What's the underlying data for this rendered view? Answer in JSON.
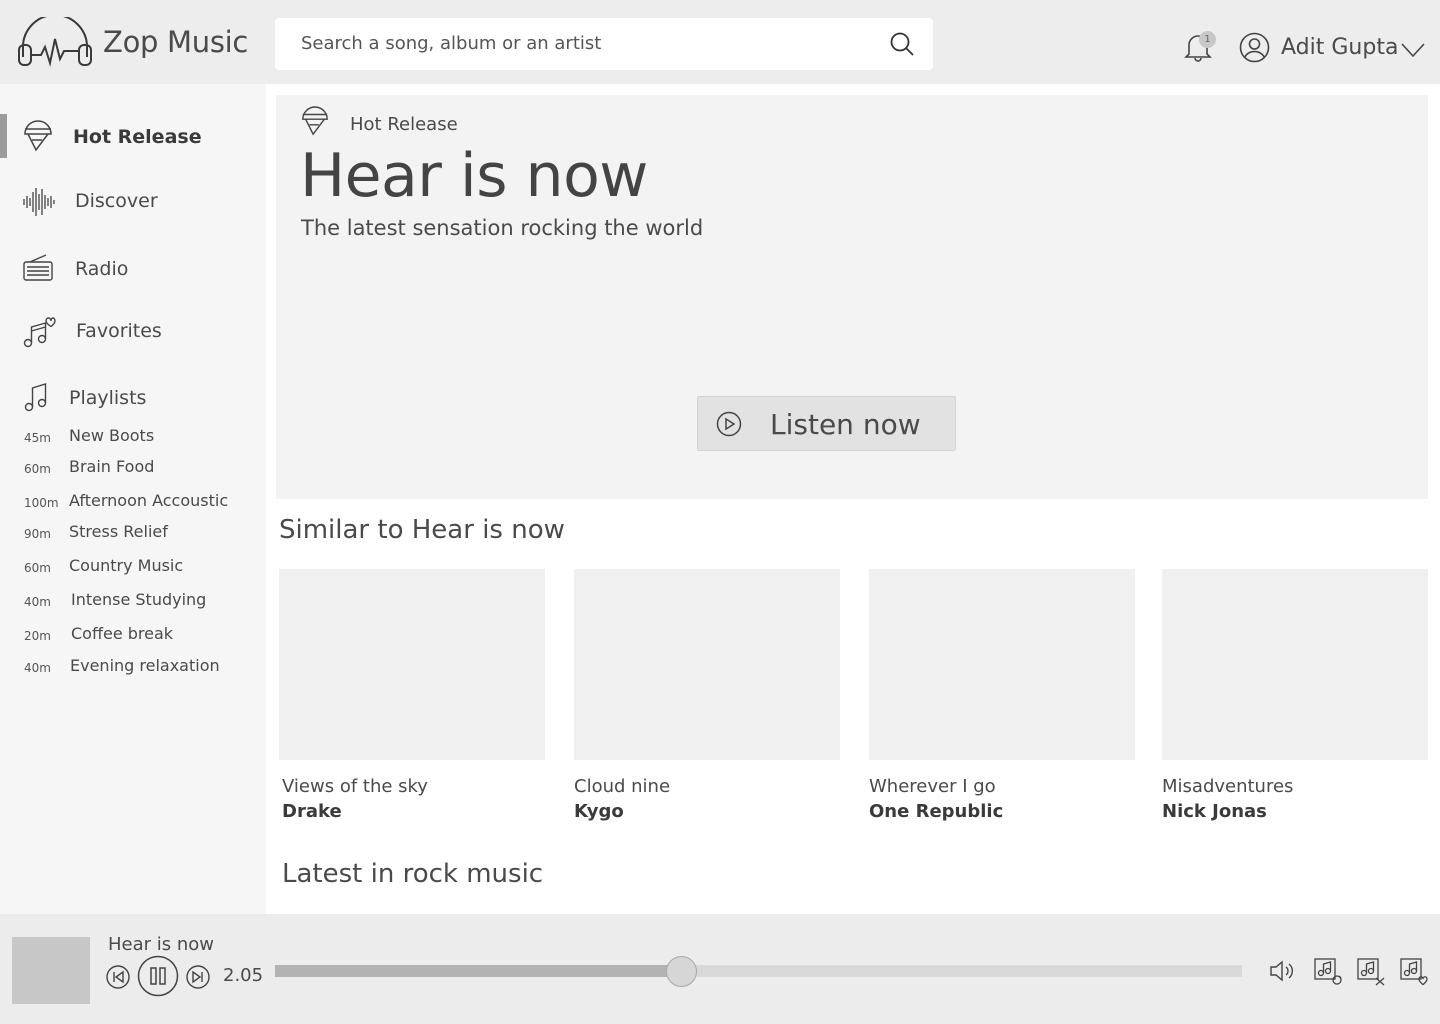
{
  "app": {
    "name": "Zop Music"
  },
  "search": {
    "placeholder": "Search a song, album or an artist"
  },
  "header": {
    "notification_count": "1",
    "user_name": "Adit Gupta"
  },
  "sidebar": {
    "nav": [
      {
        "label": "Hot Release",
        "icon": "hot-release-icon",
        "active": true
      },
      {
        "label": "Discover",
        "icon": "waveform-icon",
        "active": false
      },
      {
        "label": "Radio",
        "icon": "radio-icon",
        "active": false
      },
      {
        "label": "Favorites",
        "icon": "favorites-icon",
        "active": false
      }
    ],
    "playlists_label": "Playlists",
    "playlists": [
      {
        "duration": "45m",
        "name": "New Boots"
      },
      {
        "duration": "60m",
        "name": "Brain Food"
      },
      {
        "duration": "100m",
        "name": "Afternoon Accoustic"
      },
      {
        "duration": "90m",
        "name": "Stress Relief"
      },
      {
        "duration": "60m",
        "name": "Country Music"
      },
      {
        "duration": "40m",
        "name": "Intense Studying"
      },
      {
        "duration": "20m",
        "name": "Coffee break"
      },
      {
        "duration": "40m",
        "name": "Evening relaxation"
      }
    ]
  },
  "hero": {
    "tag": "Hot Release",
    "title": "Hear is now",
    "subtitle": "The latest sensation rocking the world",
    "button_label": "Listen now"
  },
  "similar": {
    "title": "Similar to Hear is now",
    "cards": [
      {
        "song": "Views of the sky",
        "artist": "Drake"
      },
      {
        "song": "Cloud nine",
        "artist": "Kygo"
      },
      {
        "song": "Wherever I go",
        "artist": "One Republic"
      },
      {
        "song": "Misadventures",
        "artist": "Nick Jonas"
      }
    ]
  },
  "latest": {
    "title": "Latest in rock music"
  },
  "player": {
    "now_playing": "Hear is now",
    "elapsed": "2.05",
    "progress": 0.42
  },
  "colors": {
    "header_bg": "#ededed",
    "sidebar_bg": "#f6f6f6",
    "hero_bg": "#f3f3f3",
    "player_bg": "#ececec",
    "text": "#4a4a4a"
  }
}
